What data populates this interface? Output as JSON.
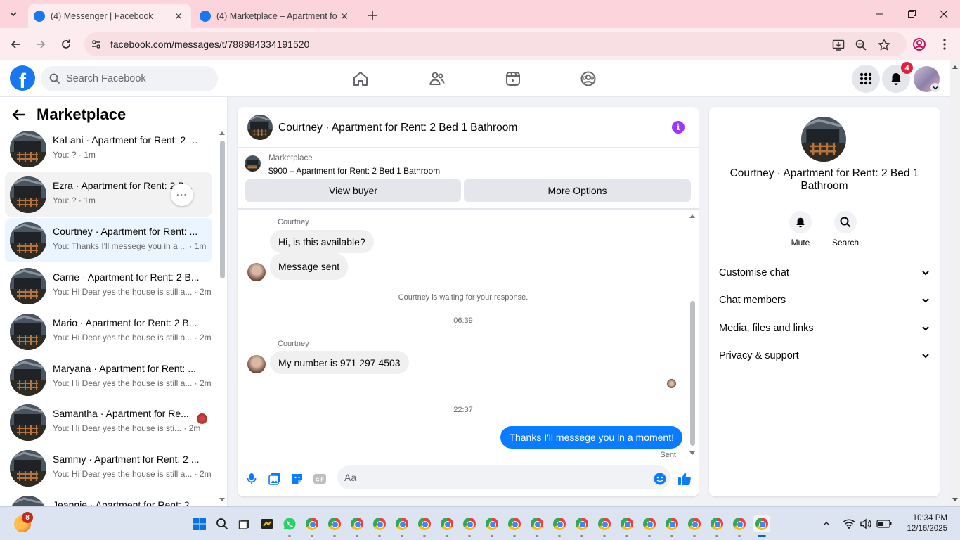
{
  "browser": {
    "tabs": [
      {
        "title": "(4) Messenger | Facebook",
        "active": true
      },
      {
        "title": "(4) Marketplace – Apartment fo",
        "active": false
      }
    ],
    "url": "facebook.com/messages/t/788984334191520"
  },
  "fb": {
    "search_placeholder": "Search Facebook",
    "notification_count": "4",
    "brand_color": "#1877f2"
  },
  "left": {
    "title": "Marketplace",
    "conversations": [
      {
        "name": "KaLani · Apartment for Rent: 2 B...",
        "preview": "You: ? · 1m"
      },
      {
        "name": "Ezra · Apartment for Rent: 2 B...",
        "preview": "You: ? · 1m"
      },
      {
        "name": "Courtney · Apartment for Rent: ...",
        "preview": "You: Thanks I'll messege you in a ... · 1m"
      },
      {
        "name": "Carrie · Apartment for Rent: 2 B...",
        "preview": "You: Hi Dear yes the house is still a... · 2m"
      },
      {
        "name": "Mario · Apartment for Rent: 2 B...",
        "preview": "You: Hi Dear yes the house is still a... · 2m"
      },
      {
        "name": "Maryana · Apartment for Rent: ...",
        "preview": "You: Hi Dear yes the house is still a... · 2m"
      },
      {
        "name": "Samantha · Apartment for Re...",
        "preview": "You: Hi Dear yes the house is sti... · 2m"
      },
      {
        "name": "Sammy · Apartment for Rent: 2 ...",
        "preview": "You: Hi Dear yes the house is still a... · 2m"
      },
      {
        "name": "Jeannie · Apartment for Rent: 2",
        "preview": ""
      }
    ]
  },
  "chat": {
    "title": "Courtney · Apartment for Rent: 2 Bed 1 Bathroom",
    "listing_label": "Marketplace",
    "listing_price": "$900 – Apartment for Rent: 2 Bed 1 Bathroom",
    "view_buyer": "View buyer",
    "more_options": "More Options",
    "sender1": "Courtney",
    "msg1": "Hi, is this available?",
    "msg2": "Message sent",
    "waiting": "Courtney is waiting for your response.",
    "time1": "06:39",
    "sender2": "Courtney",
    "msg3": "My number is 971 297 4503",
    "time2": "22:37",
    "my_msg": "Thanks I'll messege you in a moment!",
    "status": "Sent",
    "composer_placeholder": "Aa",
    "my_bubble_color": "#0a7cff"
  },
  "info": {
    "name": "Courtney · Apartment for Rent: 2 Bed 1 Bathroom",
    "mute": "Mute",
    "search": "Search",
    "sections": [
      "Customise chat",
      "Chat members",
      "Media, files and links",
      "Privacy & support"
    ]
  },
  "taskbar": {
    "weather_badge": "8",
    "time": "10:34 PM",
    "date": "12/16/2025"
  }
}
